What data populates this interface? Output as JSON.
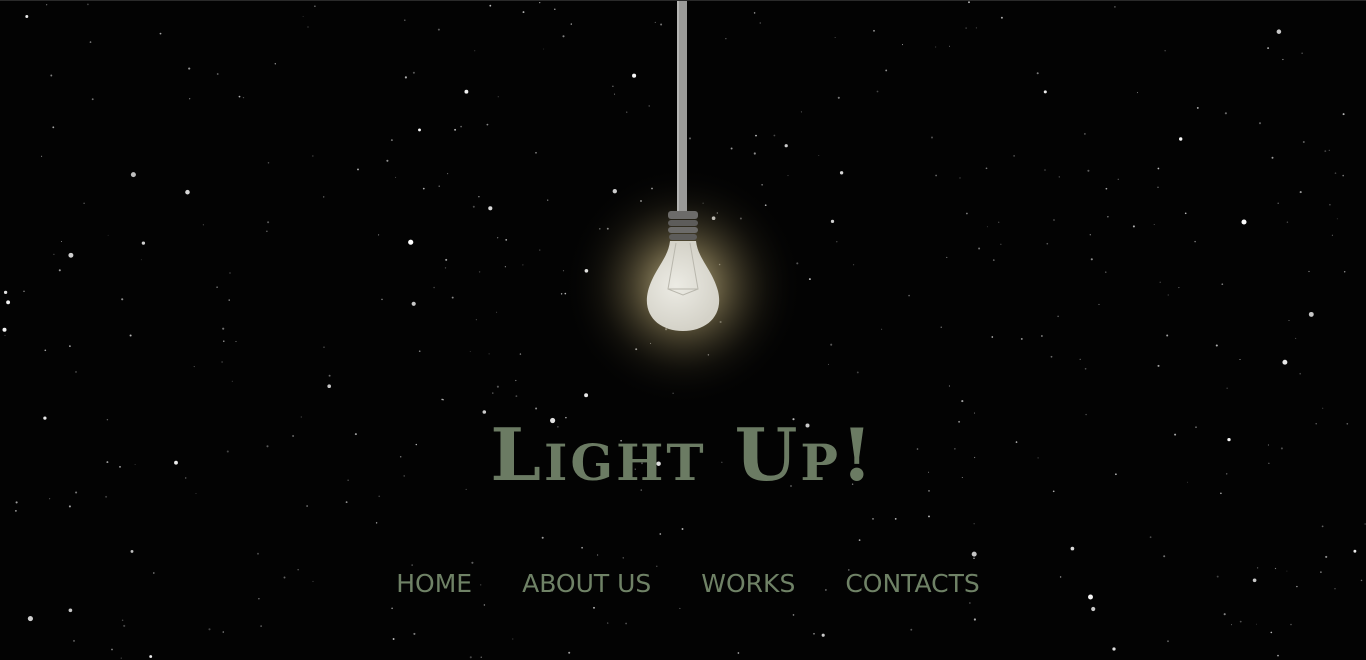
{
  "site": {
    "title": "Light Up!"
  },
  "nav": {
    "items": [
      {
        "label": "HOME"
      },
      {
        "label": "ABOUT US"
      },
      {
        "label": "WORKS"
      },
      {
        "label": "CONTACTS"
      }
    ]
  },
  "colors": {
    "background": "#030303",
    "title": "#6b7b63",
    "nav_text": "#6f8266",
    "bulb_glass": "#deddd6",
    "glow": "#d9c98a",
    "cord": "#9a9a98"
  }
}
